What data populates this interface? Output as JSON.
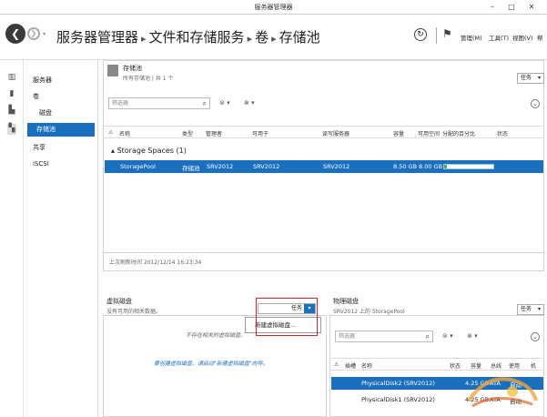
{
  "window": {
    "title": "服务器管理器"
  },
  "header": {
    "breadcrumb": [
      "服务器管理器",
      "文件和存储服务",
      "卷",
      "存储池"
    ],
    "menus": [
      "管理(M)",
      "工具(T)",
      "视图(V)",
      "帮"
    ]
  },
  "sidebar": {
    "items": [
      "服务器",
      "卷",
      "磁盘",
      "存储池",
      "共享",
      "iSCSI"
    ]
  },
  "pools": {
    "title": "存储池",
    "subtitle": "所有存储池 | 共 1 个",
    "tasks": "任务",
    "filter_placeholder": "筛选器",
    "columns": [
      "名称",
      "类型",
      "管理者",
      "可用于",
      "读写服务器",
      "容量",
      "可用空间",
      "分配的百分比",
      "状态"
    ],
    "group": "Storage Spaces (1)",
    "rows": [
      {
        "name": "StoragePool",
        "type": "存储池",
        "managed": "SRV2012",
        "available": "SRV2012",
        "rw": "SRV2012",
        "capacity": "8.50 GB",
        "free": "8.00 GB",
        "alloc_fraction": 0.06
      }
    ],
    "last_refresh": "上次刷新时间 2012/12/14 16:23:34"
  },
  "vdisks": {
    "title": "虚拟磁盘",
    "subtitle": "没有可用的相关数据。",
    "tasks": "任务",
    "menu_item": "新建虚拟磁盘...",
    "empty_text": "不存在相关的虚拟磁盘。",
    "create_link": "要创建虚拟磁盘，请启动\"新建虚拟磁盘\"向导。"
  },
  "pdisks": {
    "title": "物理磁盘",
    "subtitle": "SRV2012 上的 StoragePool",
    "tasks": "任务",
    "filter_placeholder": "筛选器",
    "columns": [
      "插槽",
      "名称",
      "状态",
      "容量",
      "总线",
      "使用",
      "机"
    ],
    "rows": [
      {
        "name": "PhysicalDisk2 (SRV2012)",
        "capacity": "4.25 GB",
        "bus": "ATA",
        "use": "自动"
      },
      {
        "name": "PhysicalDisk1 (SRV2012)",
        "capacity": "4.25 GB",
        "bus": "ATA",
        "use": "自动"
      }
    ]
  },
  "colors": {
    "accent": "#1a6fbf",
    "highlight_box": "#d8232a",
    "progress": "#3cb84a"
  }
}
